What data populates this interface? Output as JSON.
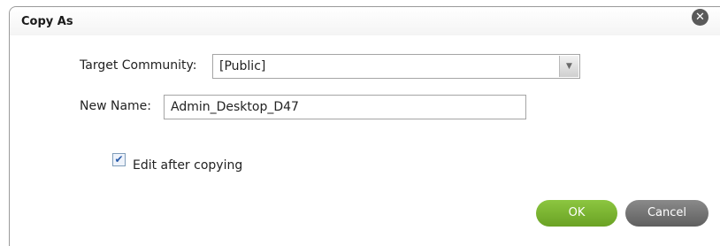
{
  "dialog": {
    "title": "Copy As",
    "close_icon": "close-icon"
  },
  "form": {
    "target_community_label": "Target Community:",
    "target_community_value": "[Public]",
    "new_name_label": "New Name:",
    "new_name_value": "Admin_Desktop_D47",
    "edit_after_copying_label": "Edit after copying",
    "edit_after_copying_checked": true
  },
  "buttons": {
    "ok_label": "OK",
    "cancel_label": "Cancel"
  },
  "colors": {
    "ok_button": "#7ab332",
    "cancel_button": "#707070"
  }
}
